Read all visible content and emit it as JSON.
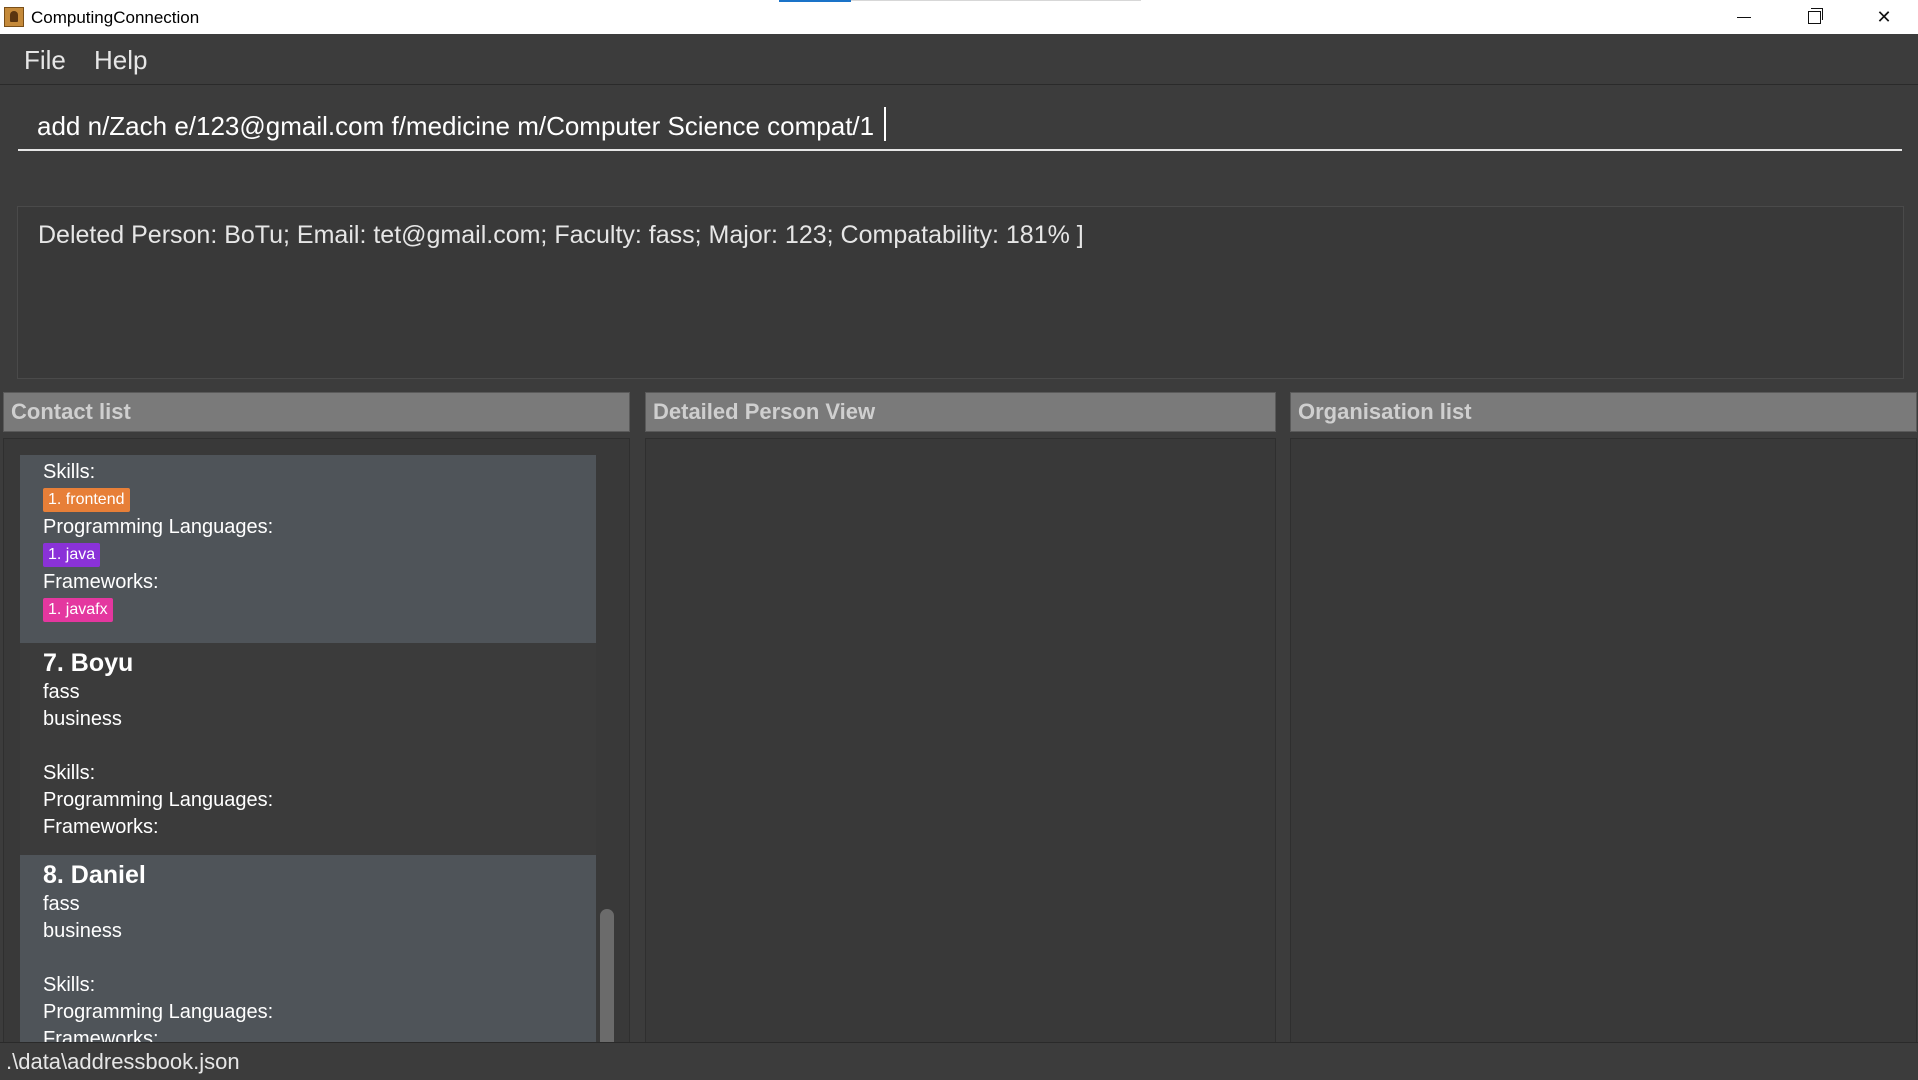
{
  "window": {
    "title": "ComputingConnection",
    "controls": {
      "minimize": "minimize-icon",
      "maximize": "restore-icon",
      "close": "close-icon"
    }
  },
  "menu": {
    "file": "File",
    "help": "Help"
  },
  "command": {
    "value": "add n/Zach e/123@gmail.com f/medicine m/Computer Science compat/1"
  },
  "result": {
    "text": "Deleted Person: BoTu; Email: tet@gmail.com; Faculty: fass; Major: 123; Compatability: 181% ]"
  },
  "panels": {
    "contact_list": "Contact list",
    "detail_view": "Detailed Person View",
    "organisation_list": "Organisation list"
  },
  "contacts": {
    "partial": {
      "skills_label": "Skills:",
      "skill_tag": "1. frontend",
      "languages_label": "Programming Languages:",
      "language_tag": "1. java",
      "frameworks_label": "Frameworks:",
      "framework_tag": "1. javafx"
    },
    "items": [
      {
        "name": "7.  Boyu",
        "faculty": "fass",
        "major": "business",
        "skills_label": "Skills:",
        "languages_label": "Programming Languages:",
        "frameworks_label": "Frameworks:"
      },
      {
        "name": "8.  Daniel",
        "faculty": "fass",
        "major": "business",
        "skills_label": "Skills:",
        "languages_label": "Programming Languages:",
        "frameworks_label": "Frameworks:"
      }
    ]
  },
  "status": {
    "path": ".\\data\\addressbook.json"
  },
  "colors": {
    "background": "#3c3c3c",
    "panel_header": "#7a7a7a",
    "card_light": "#4f5459",
    "card_dark": "#3b3b3b",
    "skill_tag": "#e77f38",
    "language_tag": "#8a32d8",
    "framework_tag": "#e4379f"
  }
}
